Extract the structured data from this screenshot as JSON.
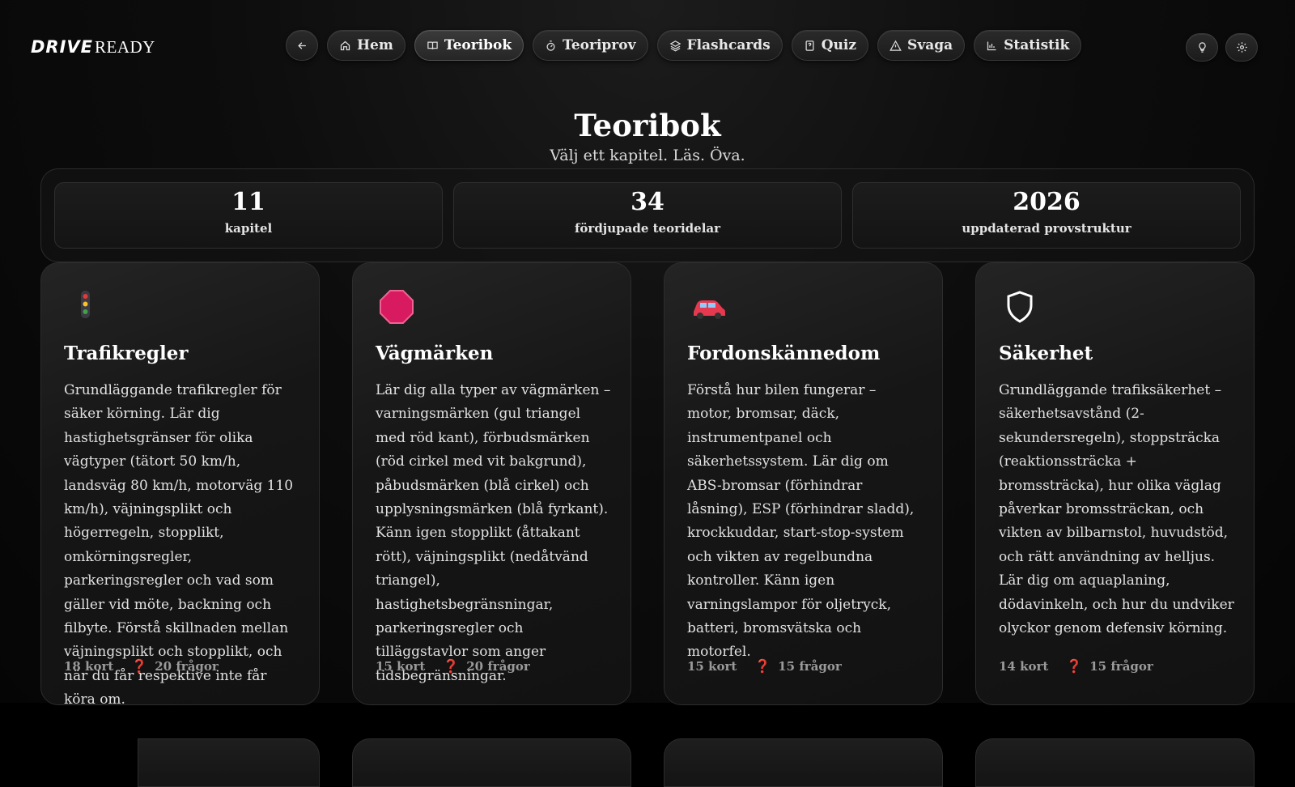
{
  "brand": {
    "part1": "DRIVE",
    "part2": "READY"
  },
  "nav": {
    "back_icon": "arrow-left-icon",
    "items": [
      {
        "label": "Hem",
        "icon": "home-icon",
        "active": false
      },
      {
        "label": "Teoribok",
        "icon": "book-icon",
        "active": true
      },
      {
        "label": "Teoriprov",
        "icon": "stopwatch-icon",
        "active": false
      },
      {
        "label": "Flashcards",
        "icon": "layers-icon",
        "active": false
      },
      {
        "label": "Quiz",
        "icon": "quiz-icon",
        "active": false
      },
      {
        "label": "Svaga",
        "icon": "warning-icon",
        "active": false
      },
      {
        "label": "Statistik",
        "icon": "bar-chart-icon",
        "active": false
      }
    ],
    "right_icons": [
      "lightbulb-icon",
      "gear-icon"
    ]
  },
  "page": {
    "title": "Teoribok",
    "subtitle": "Välj ett kapitel. Läs. Öva."
  },
  "stats": [
    {
      "value": "11",
      "label": "kapitel"
    },
    {
      "value": "34",
      "label": "fördjupade teoridelar"
    },
    {
      "value": "2026",
      "label": "uppdaterad provstruktur"
    }
  ],
  "chapters": [
    {
      "icon": "traffic-light-icon",
      "title": "Trafikregler",
      "description": "Grundläggande trafikregler för säker körning. Lär dig hastighetsgränser för olika vägtyper (tätort 50 km/h, landsväg 80 km/h, motorväg 110 km/h), väjningsplikt och högerregeln, stopplikt, omkörningsregler, parkeringsregler och vad som gäller vid möte, backning och filbyte. Förstå skillnaden mellan väjningsplikt och stopplikt, och när du får respektive inte får köra om.",
      "cards": "18 kort",
      "questions": "20 frågor"
    },
    {
      "icon": "stop-sign-icon",
      "title": "Vägmärken",
      "description": "Lär dig alla typer av vägmärken – varningsmärken (gul triangel med röd kant), förbudsmärken (röd cirkel med vit bakgrund), påbudsmärken (blå cirkel) och upplysningsmärken (blå fyrkant). Känn igen stopplikt (åttakant rött), väjningsplikt (nedåtvänd triangel), hastighetsbegränsningar, parkeringsregler och tilläggstavlor som anger tidsbegränsningar.",
      "cards": "15 kort",
      "questions": "20 frågor"
    },
    {
      "icon": "car-icon",
      "title": "Fordonskännedom",
      "description": "Förstå hur bilen fungerar – motor, bromsar, däck, instrumentpanel och säkerhetssystem. Lär dig om ABS-bromsar (förhindrar låsning), ESP (förhindrar sladd), krockkuddar, start-stop-system och vikten av regelbundna kontroller. Känn igen varningslampor för oljetryck, batteri, bromsvätska och motorfel.",
      "cards": "15 kort",
      "questions": "15 frågor"
    },
    {
      "icon": "shield-icon",
      "title": "Säkerhet",
      "description": "Grundläggande trafiksäkerhet – säkerhetsavstånd (2-sekundersregeln), stoppsträcka (reaktionssträcka + bromssträcka), hur olika väglag påverkar bromssträckan, och vikten av bilbarnstol, huvudstöd, och rätt användning av helljus. Lär dig om aquaplaning, dödavinkeln, och hur du undviker olyckor genom defensiv körning.",
      "cards": "14 kort",
      "questions": "15 frågor"
    }
  ],
  "colors": {
    "accent": "#e0335c",
    "background": "#0d0d0d"
  }
}
